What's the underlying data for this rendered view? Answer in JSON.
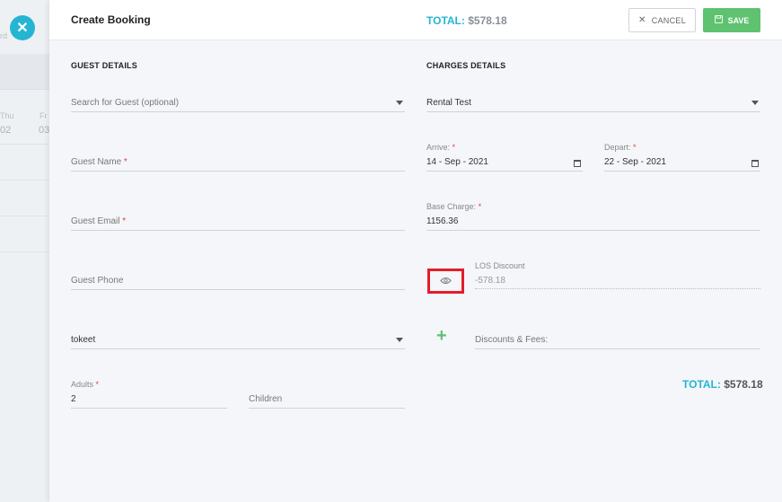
{
  "background": {
    "partial_text": "rd",
    "days": [
      {
        "dow": "Thu",
        "num": "02"
      },
      {
        "dow": "Fr",
        "num": "03"
      }
    ]
  },
  "header": {
    "title": "Create Booking",
    "total_label": "TOTAL:",
    "total_value": "$578.18",
    "cancel_label": "CANCEL",
    "save_label": "SAVE"
  },
  "guest": {
    "section_title": "GUEST DETAILS",
    "search_placeholder": "Search for Guest (optional)",
    "name_label": "Guest Name",
    "email_label": "Guest Email",
    "phone_label": "Guest Phone",
    "source_value": "tokeet",
    "adults_label": "Adults",
    "adults_value": "2",
    "children_label": "Children",
    "required_mark": "*"
  },
  "charges": {
    "section_title": "CHARGES DETAILS",
    "rental_value": "Rental Test",
    "arrive_label": "Arrive:",
    "arrive_value": "14 - Sep - 2021",
    "depart_label": "Depart:",
    "depart_value": "22 - Sep - 2021",
    "base_label": "Base Charge:",
    "base_value": "1156.36",
    "los_label": "LOS Discount",
    "los_value": "-578.18",
    "discounts_label": "Discounts & Fees:",
    "total_label": "TOTAL:",
    "total_value": "$578.18"
  },
  "colors": {
    "accent": "#25b5d3",
    "save_green": "#5ec270",
    "highlight_red": "#e31d2a",
    "required_red": "#e0443b"
  },
  "icons": [
    "close-icon",
    "x-icon",
    "save-icon",
    "chevron-down-icon",
    "calendar-icon",
    "eye-icon",
    "plus-icon"
  ]
}
